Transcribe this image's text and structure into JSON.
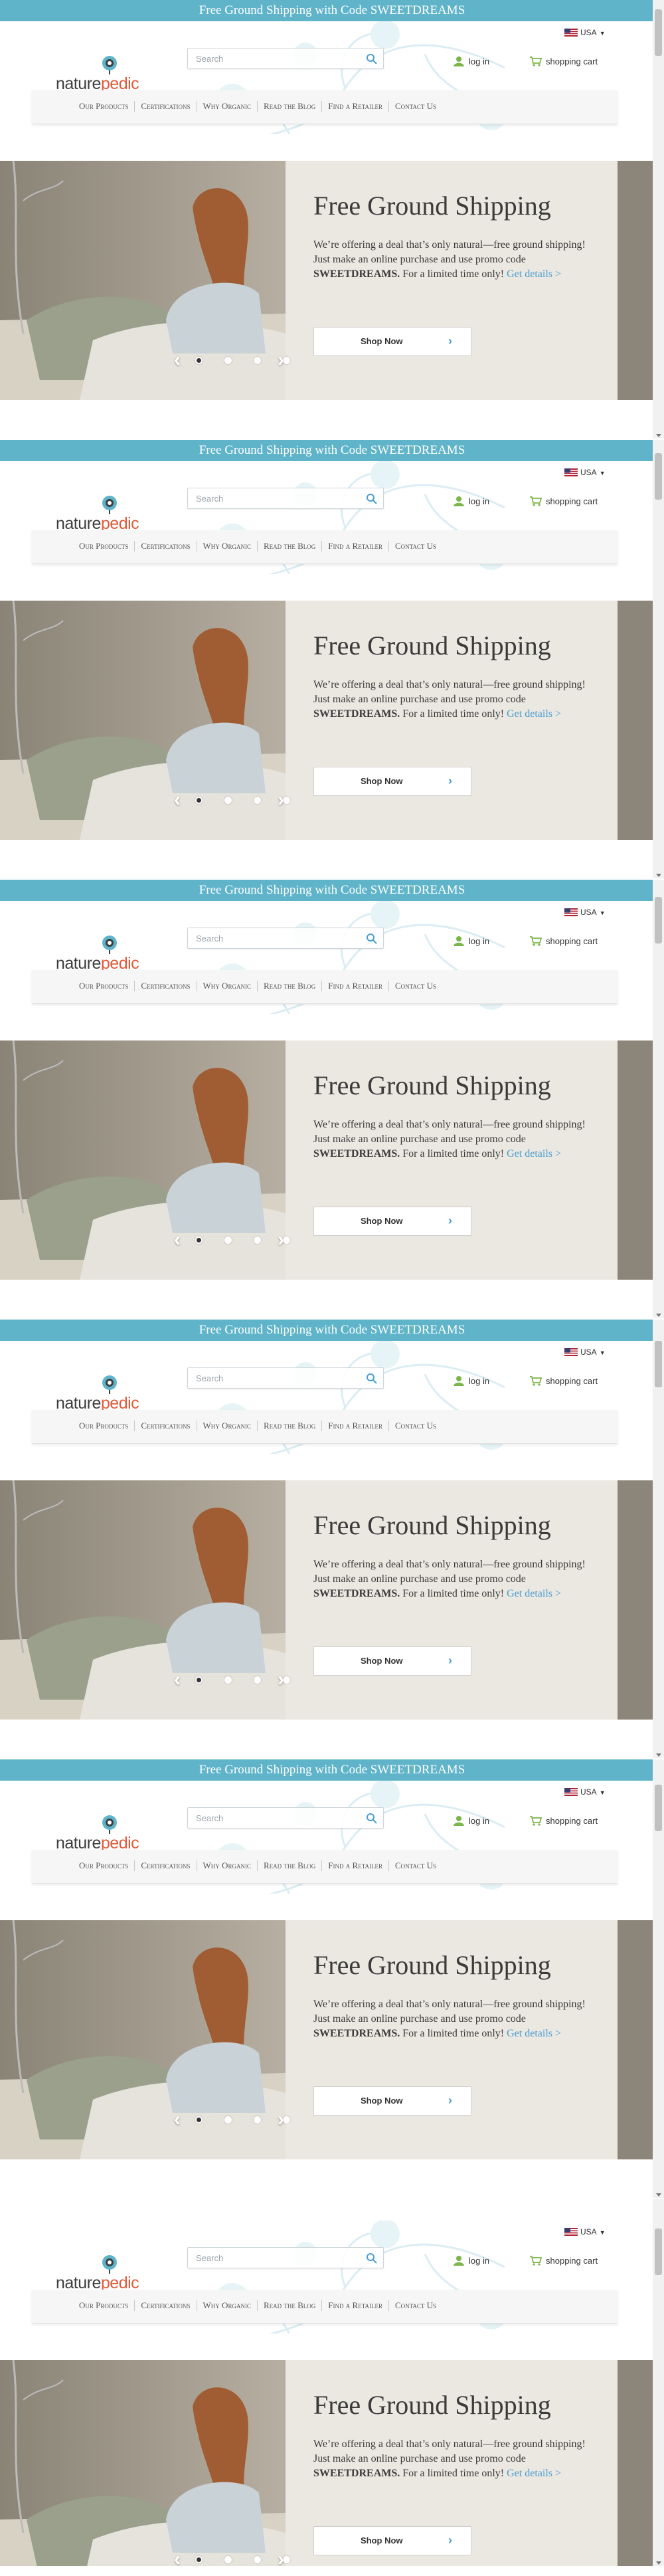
{
  "banner": {
    "text": "Free Ground Shipping with Code SWEETDREAMS"
  },
  "header": {
    "logo": {
      "part1": "nature",
      "part2": "pedic"
    },
    "search": {
      "placeholder": "Search"
    },
    "region": {
      "label": "USA"
    },
    "login": {
      "label": "log in"
    },
    "cart": {
      "label": "shopping cart"
    }
  },
  "nav": {
    "items": [
      "Our Products",
      "Certifications",
      "Why Organic",
      "Read the Blog",
      "Find a Retailer",
      "Contact Us"
    ]
  },
  "hero": {
    "title": "Free Ground Shipping",
    "body_prefix": "We’re offering a deal that’s only natural—free ground shipping! Just make an online purchase and use promo code ",
    "promo_code": "SWEETDREAMS.",
    "body_suffix": " For a limited time only! ",
    "details_link": "Get details >",
    "button_label": "Shop Now",
    "slides": 4,
    "active_slide": 1
  },
  "colors": {
    "banner": "#5fb4c9",
    "logo_accent": "#e35a3a",
    "link": "#4a9fd0",
    "icon_green": "#7ab648"
  },
  "icons": [
    "search-icon",
    "us-flag-icon",
    "user-icon",
    "cart-icon",
    "chevron-right-icon",
    "arrow-left-icon",
    "arrow-right-icon",
    "logo-flower-icon"
  ]
}
